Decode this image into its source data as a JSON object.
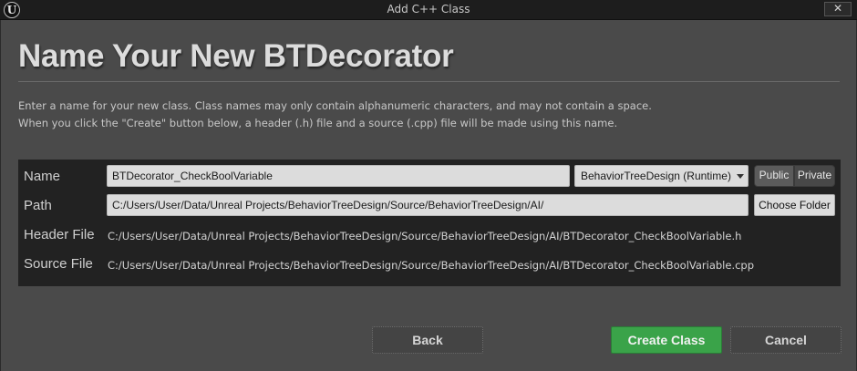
{
  "window": {
    "title": "Add C++ Class",
    "logo_glyph": "U",
    "close_glyph": "✕"
  },
  "heading": "Name Your New BTDecorator",
  "description": {
    "line1": "Enter a name for your new class. Class names may only contain alphanumeric characters, and may not contain a space.",
    "line2": "When you click the \"Create\" button below, a header (.h) file and a source (.cpp) file will be made using this name."
  },
  "form": {
    "name_label": "Name",
    "name_value": "BTDecorator_CheckBoolVariable",
    "module_selected": "BehaviorTreeDesign (Runtime)",
    "public_label": "Public",
    "private_label": "Private",
    "path_label": "Path",
    "path_value": "C:/Users/User/Data/Unreal Projects/BehaviorTreeDesign/Source/BehaviorTreeDesign/AI/",
    "choose_folder_label": "Choose Folder",
    "header_label": "Header File",
    "header_value": "C:/Users/User/Data/Unreal Projects/BehaviorTreeDesign/Source/BehaviorTreeDesign/AI/BTDecorator_CheckBoolVariable.h",
    "source_label": "Source File",
    "source_value": "C:/Users/User/Data/Unreal Projects/BehaviorTreeDesign/Source/BehaviorTreeDesign/AI/BTDecorator_CheckBoolVariable.cpp"
  },
  "buttons": {
    "back": "Back",
    "create": "Create Class",
    "cancel": "Cancel"
  },
  "colors": {
    "create_button": "#3aa349",
    "panel_bg": "#222222",
    "dialog_bg": "#4a4a4a"
  }
}
